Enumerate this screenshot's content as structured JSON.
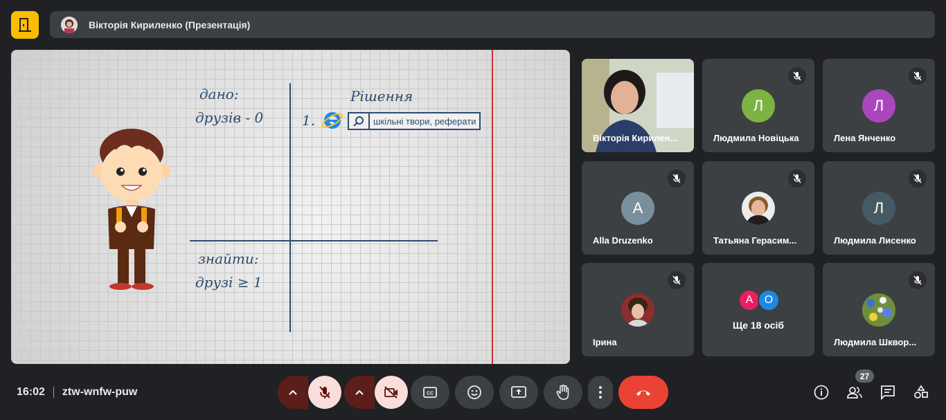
{
  "header": {
    "presenter_label": "Вікторія Кириленко (Презентація)",
    "logo_icon": "door-exit-icon"
  },
  "slide": {
    "dano": "дано:",
    "druziv": "друзів - 0",
    "rishennia": "Рішення",
    "step_number": "1.",
    "search_text": "шкільні твори, реферати",
    "znaity": "знайти:",
    "druzi": "друзі ≥ 1",
    "accent_red": "#d32f2f",
    "ink_color": "#2d4a6e"
  },
  "participants": [
    {
      "name": "Вікторія Кирилен...",
      "type": "video",
      "muted": false
    },
    {
      "name": "Людмила Новіцька",
      "initial": "Л",
      "color": "#7cb342",
      "muted": true
    },
    {
      "name": "Лена Янченко",
      "initial": "Л",
      "color": "#ab47bc",
      "muted": true
    },
    {
      "name": "Alla Druzenko",
      "initial": "A",
      "color": "#78909c",
      "muted": true
    },
    {
      "name": "Татьяна Герасим...",
      "type": "photo",
      "muted": true
    },
    {
      "name": "Людмила Лисенко",
      "initial": "Л",
      "color": "#455a64",
      "muted": true
    },
    {
      "name": "Ірина",
      "type": "photo",
      "muted": true
    },
    {
      "name": "Ще 18 осіб",
      "avatars": [
        "A",
        "O"
      ],
      "avatar_colors": [
        "#e91e63",
        "#1e88e5"
      ]
    },
    {
      "name": "Людмила Шквор...",
      "type": "photo",
      "muted": true
    }
  ],
  "footer": {
    "time": "16:02",
    "meeting_code": "ztw-wnfw-puw",
    "participant_count": "27",
    "hangup_color": "#ea4335"
  }
}
